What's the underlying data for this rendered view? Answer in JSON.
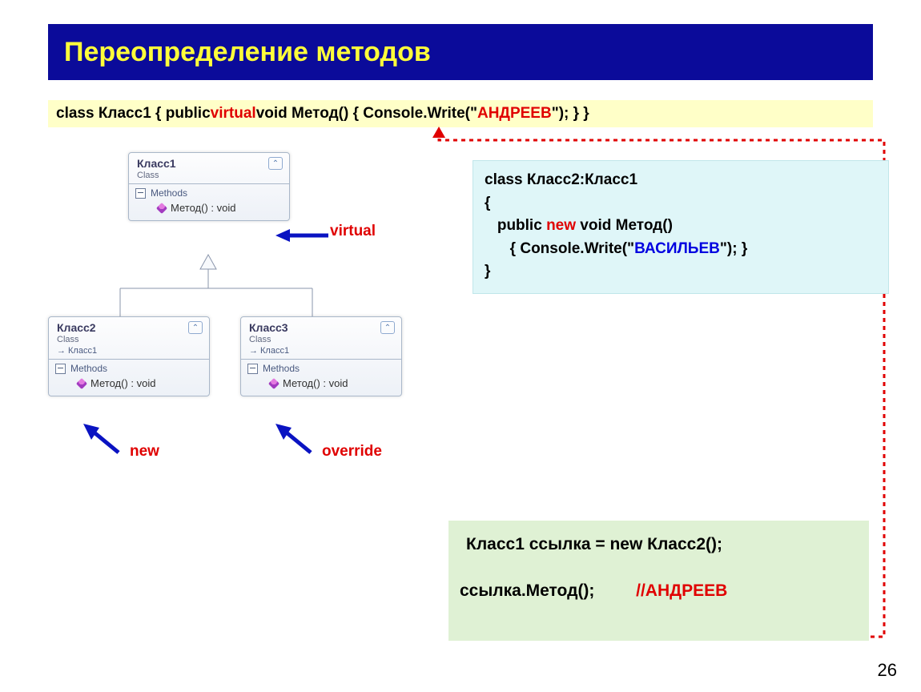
{
  "slide": {
    "title": "Переопределение методов",
    "page_number": "26"
  },
  "code_strip": {
    "p1": "class Класс1  {   public ",
    "kw_virtual": "virtual",
    "p2": " void Метод() { Console.Write(\"",
    "name_red": "АНДРЕЕВ",
    "p3": "\"); }   }"
  },
  "uml": {
    "class1": {
      "name": "Класс1",
      "stereotype": "Class",
      "section": "Methods",
      "method": "Метод() : void"
    },
    "class2": {
      "name": "Класс2",
      "stereotype": "Class",
      "inherits": "Класс1",
      "section": "Methods",
      "method": "Метод() : void"
    },
    "class3": {
      "name": "Класс3",
      "stereotype": "Class",
      "inherits": "Класс1",
      "section": "Methods",
      "method": "Метод() : void"
    }
  },
  "annotations": {
    "virtual": "virtual",
    "new": "new",
    "override": "override"
  },
  "code_cyan": {
    "l1": "class Класс2:Класс1",
    "l2": "{",
    "l3a": "   public ",
    "l3_new": "new",
    "l3b": " void Метод()",
    "l4a": "      { Console.Write(\"",
    "l4_name": "ВАСИЛЬЕВ",
    "l4b": "\"); }",
    "l5": "}"
  },
  "code_green": {
    "l1": "Класс1 ссылка = new Класс2();",
    "l2a": "ссылка.Метод();",
    "l2b": "//",
    "l2c": "АНДРЕЕВ"
  }
}
